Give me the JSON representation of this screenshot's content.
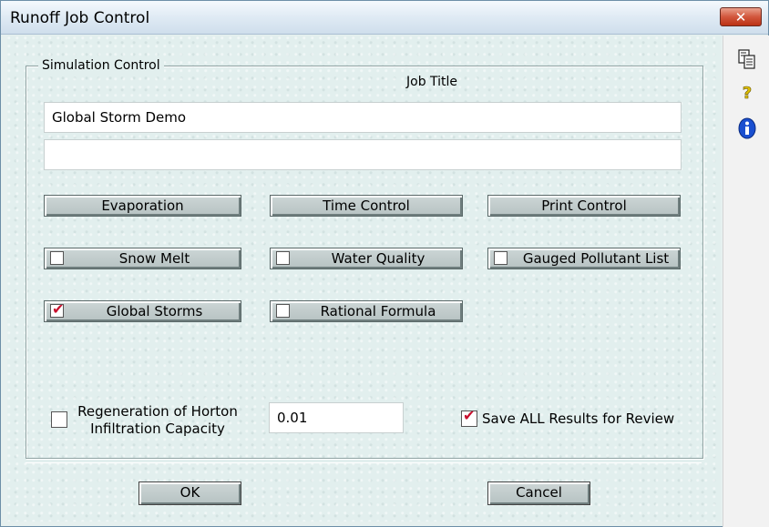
{
  "window": {
    "title": "Runoff Job Control",
    "close_label": "✕"
  },
  "group": {
    "label": "Simulation Control",
    "job_title_label": "Job Title",
    "job_title_line1": "Global Storm Demo",
    "job_title_line2": ""
  },
  "buttons": {
    "evaporation": "Evaporation",
    "time_control": "Time Control",
    "print_control": "Print Control"
  },
  "options": {
    "snow_melt": {
      "label": "Snow Melt",
      "checked": false
    },
    "water_quality": {
      "label": "Water Quality",
      "checked": false
    },
    "gauged_pollutant_list": {
      "label": "Gauged Pollutant List",
      "checked": false
    },
    "global_storms": {
      "label": "Global Storms",
      "checked": true
    },
    "rational_formula": {
      "label": "Rational Formula",
      "checked": false
    }
  },
  "horton": {
    "label_line1": "Regeneration of Horton",
    "label_line2": "Infiltration Capacity",
    "checked": false,
    "value": "0.01"
  },
  "save_all": {
    "label": "Save ALL Results for Review",
    "checked": true
  },
  "footer": {
    "ok_label": "OK",
    "cancel_label": "Cancel"
  },
  "sidebar": {
    "icons": [
      "copy-icon",
      "help-icon",
      "info-icon"
    ]
  },
  "colors": {
    "accent_check": "#c8102e",
    "close_button": "#c9452a",
    "info_icon": "#1a4fd0",
    "help_icon": "#e0c000"
  }
}
